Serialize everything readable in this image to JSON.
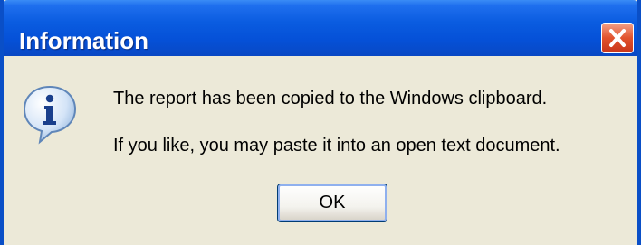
{
  "dialog": {
    "title": "Information",
    "icon": "info-icon",
    "close_icon": "close-icon",
    "message_line1": "The report has been copied to the Windows clipboard.",
    "message_line2": "If you like, you may paste it into an open text document.",
    "ok_label": "OK"
  },
  "colors": {
    "titlebar": "#0a5ce0",
    "window_frame": "#0a4fc7",
    "client_background": "#ece9d8",
    "close_button": "#e2532d"
  }
}
